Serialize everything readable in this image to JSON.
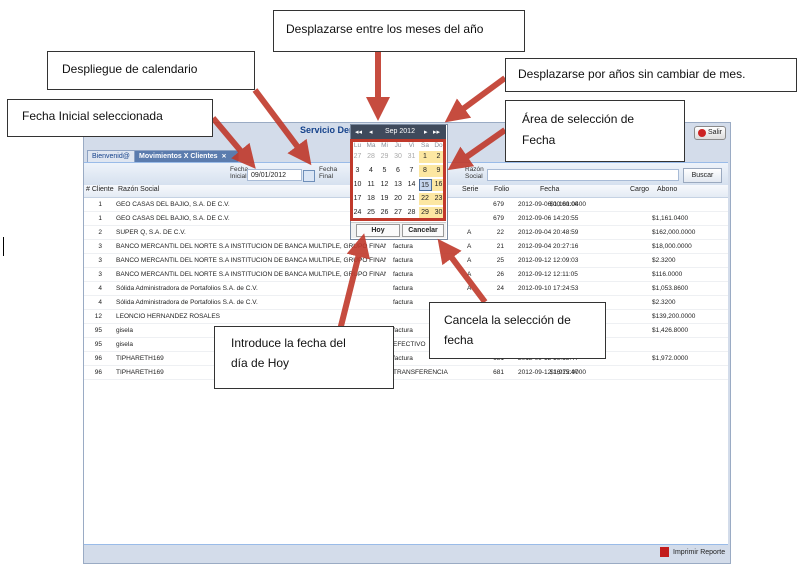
{
  "app": {
    "title": "Servicio Den",
    "salir": "Salir",
    "tabs": [
      {
        "label": "Bienvenid@"
      },
      {
        "label": "Movimientos X Clientes"
      }
    ],
    "tab_close": "✕",
    "filters": {
      "fecha_inicial_label1": "Fecha",
      "fecha_inicial_label2": "Inicial",
      "fecha_inicial_value": "09/01/2012",
      "fecha_final_label1": "Fecha",
      "fecha_final_label2": "Final",
      "razon_label1": "Razón",
      "razon_label2": "Social",
      "buscar": "Buscar"
    },
    "grid": {
      "headers": [
        "# Cliente",
        "Razón Social",
        "Serie",
        "Folio",
        "Fecha",
        "Cargo",
        "Abono"
      ],
      "rows": [
        {
          "cliente": "1",
          "razon": "GEO CASAS DEL BAJIO, S.A. DE C.V.",
          "tipo": "",
          "serie": "",
          "folio": "679",
          "fecha": "2012-09-06 00:00:00",
          "cargo": "$1,161.0400",
          "abono": ""
        },
        {
          "cliente": "1",
          "razon": "GEO CASAS DEL BAJIO, S.A. DE C.V.",
          "tipo": "",
          "serie": "",
          "folio": "679",
          "fecha": "2012-09-06 14:20:55",
          "cargo": "",
          "abono": "$1,161.0400"
        },
        {
          "cliente": "2",
          "razon": "SUPER Q, S.A. DE C.V.",
          "tipo": "",
          "serie": "A",
          "folio": "22",
          "fecha": "2012-09-04 20:48:59",
          "cargo": "",
          "abono": "$162,000.0000"
        },
        {
          "cliente": "3",
          "razon": "BANCO MERCANTIL DEL NORTE S.A INSTITUCION DE BANCA MULTIPLE, GRUPO FINANC",
          "tipo": "factura",
          "serie": "A",
          "folio": "21",
          "fecha": "2012-09-04 20:27:16",
          "cargo": "",
          "abono": "$18,000.0000"
        },
        {
          "cliente": "3",
          "razon": "BANCO MERCANTIL DEL NORTE S.A INSTITUCION DE BANCA MULTIPLE, GRUPO FINANC",
          "tipo": "factura",
          "serie": "A",
          "folio": "25",
          "fecha": "2012-09-12 12:09:03",
          "cargo": "",
          "abono": "$2.3200"
        },
        {
          "cliente": "3",
          "razon": "BANCO MERCANTIL DEL NORTE S.A INSTITUCION DE BANCA MULTIPLE, GRUPO FINANC",
          "tipo": "factura",
          "serie": "A",
          "folio": "26",
          "fecha": "2012-09-12 12:11:05",
          "cargo": "",
          "abono": "$116.0000"
        },
        {
          "cliente": "4",
          "razon": "Sólida Administradora de Portafolios S.A. de C.V.",
          "tipo": "factura",
          "serie": "A",
          "folio": "24",
          "fecha": "2012-09-10 17:24:53",
          "cargo": "",
          "abono": "$1,053.8600"
        },
        {
          "cliente": "4",
          "razon": "Sólida Administradora de Portafolios S.A. de C.V.",
          "tipo": "factura",
          "serie": "",
          "folio": "",
          "fecha": "",
          "cargo": "",
          "abono": "$2.3200"
        },
        {
          "cliente": "12",
          "razon": "LEONCIO HERNANDEZ ROSALES",
          "tipo": "",
          "serie": "",
          "folio": "",
          "fecha": "",
          "cargo": "",
          "abono": "$139,200.0000"
        },
        {
          "cliente": "95",
          "razon": "gisela",
          "tipo": "factura",
          "serie": "",
          "folio": "",
          "fecha": "",
          "cargo": "",
          "abono": "$1,426.8000"
        },
        {
          "cliente": "95",
          "razon": "gisela",
          "tipo": "EFECTIVO",
          "serie": "",
          "folio": "",
          "fecha": "",
          "cargo": "$1,426.8000",
          "abono": ""
        },
        {
          "cliente": "96",
          "razon": "TIPHARETH169",
          "tipo": "factura",
          "serie": "",
          "folio": "681",
          "fecha": "2012-09-12 16:15:47",
          "cargo": "",
          "abono": "$1,972.0000"
        },
        {
          "cliente": "96",
          "razon": "TIPHARETH169",
          "tipo": "TRANSFERENCIA",
          "serie": "",
          "folio": "681",
          "fecha": "2012-09-12 16:15:47",
          "cargo": "$1,972.0000",
          "abono": ""
        }
      ]
    },
    "footer": {
      "imprimir": "Imprimir Reporte"
    }
  },
  "calendar": {
    "prev_year": "◂◂",
    "prev_month": "◂",
    "month_label": "Sep 2012",
    "next_month": "▸",
    "next_year": "▸▸",
    "weekdays": [
      "Lu",
      "Ma",
      "Mi",
      "Ju",
      "Vi",
      "Sa",
      "Do"
    ],
    "weeks": [
      [
        "27",
        "28",
        "29",
        "30",
        "31",
        "1",
        "2"
      ],
      [
        "3",
        "4",
        "5",
        "6",
        "7",
        "8",
        "9"
      ],
      [
        "10",
        "11",
        "12",
        "13",
        "14",
        "15",
        "16"
      ],
      [
        "17",
        "18",
        "19",
        "20",
        "21",
        "22",
        "23"
      ],
      [
        "24",
        "25",
        "26",
        "27",
        "28",
        "29",
        "30"
      ]
    ],
    "selected_day": "15",
    "hoy": "Hoy",
    "cancelar": "Cancelar"
  },
  "annotations": {
    "meses": "Desplazarse entre los meses del año",
    "despliegue": "Despliegue de calendario",
    "anios": "Desplazarse  por años sin cambiar de mes.",
    "fecha_inicial": "Fecha Inicial seleccionada",
    "area_line1": "Área de selección de",
    "area_line2": "Fecha",
    "hoy_line1": "Introduce la fecha del",
    "hoy_line2": "día de Hoy",
    "cancela_line1": "Cancela la selección de",
    "cancela_line2": "fecha"
  },
  "colors": {
    "arrow": "#c0392b",
    "header_blue": "#15428b",
    "weekend": "#fce7a2"
  }
}
